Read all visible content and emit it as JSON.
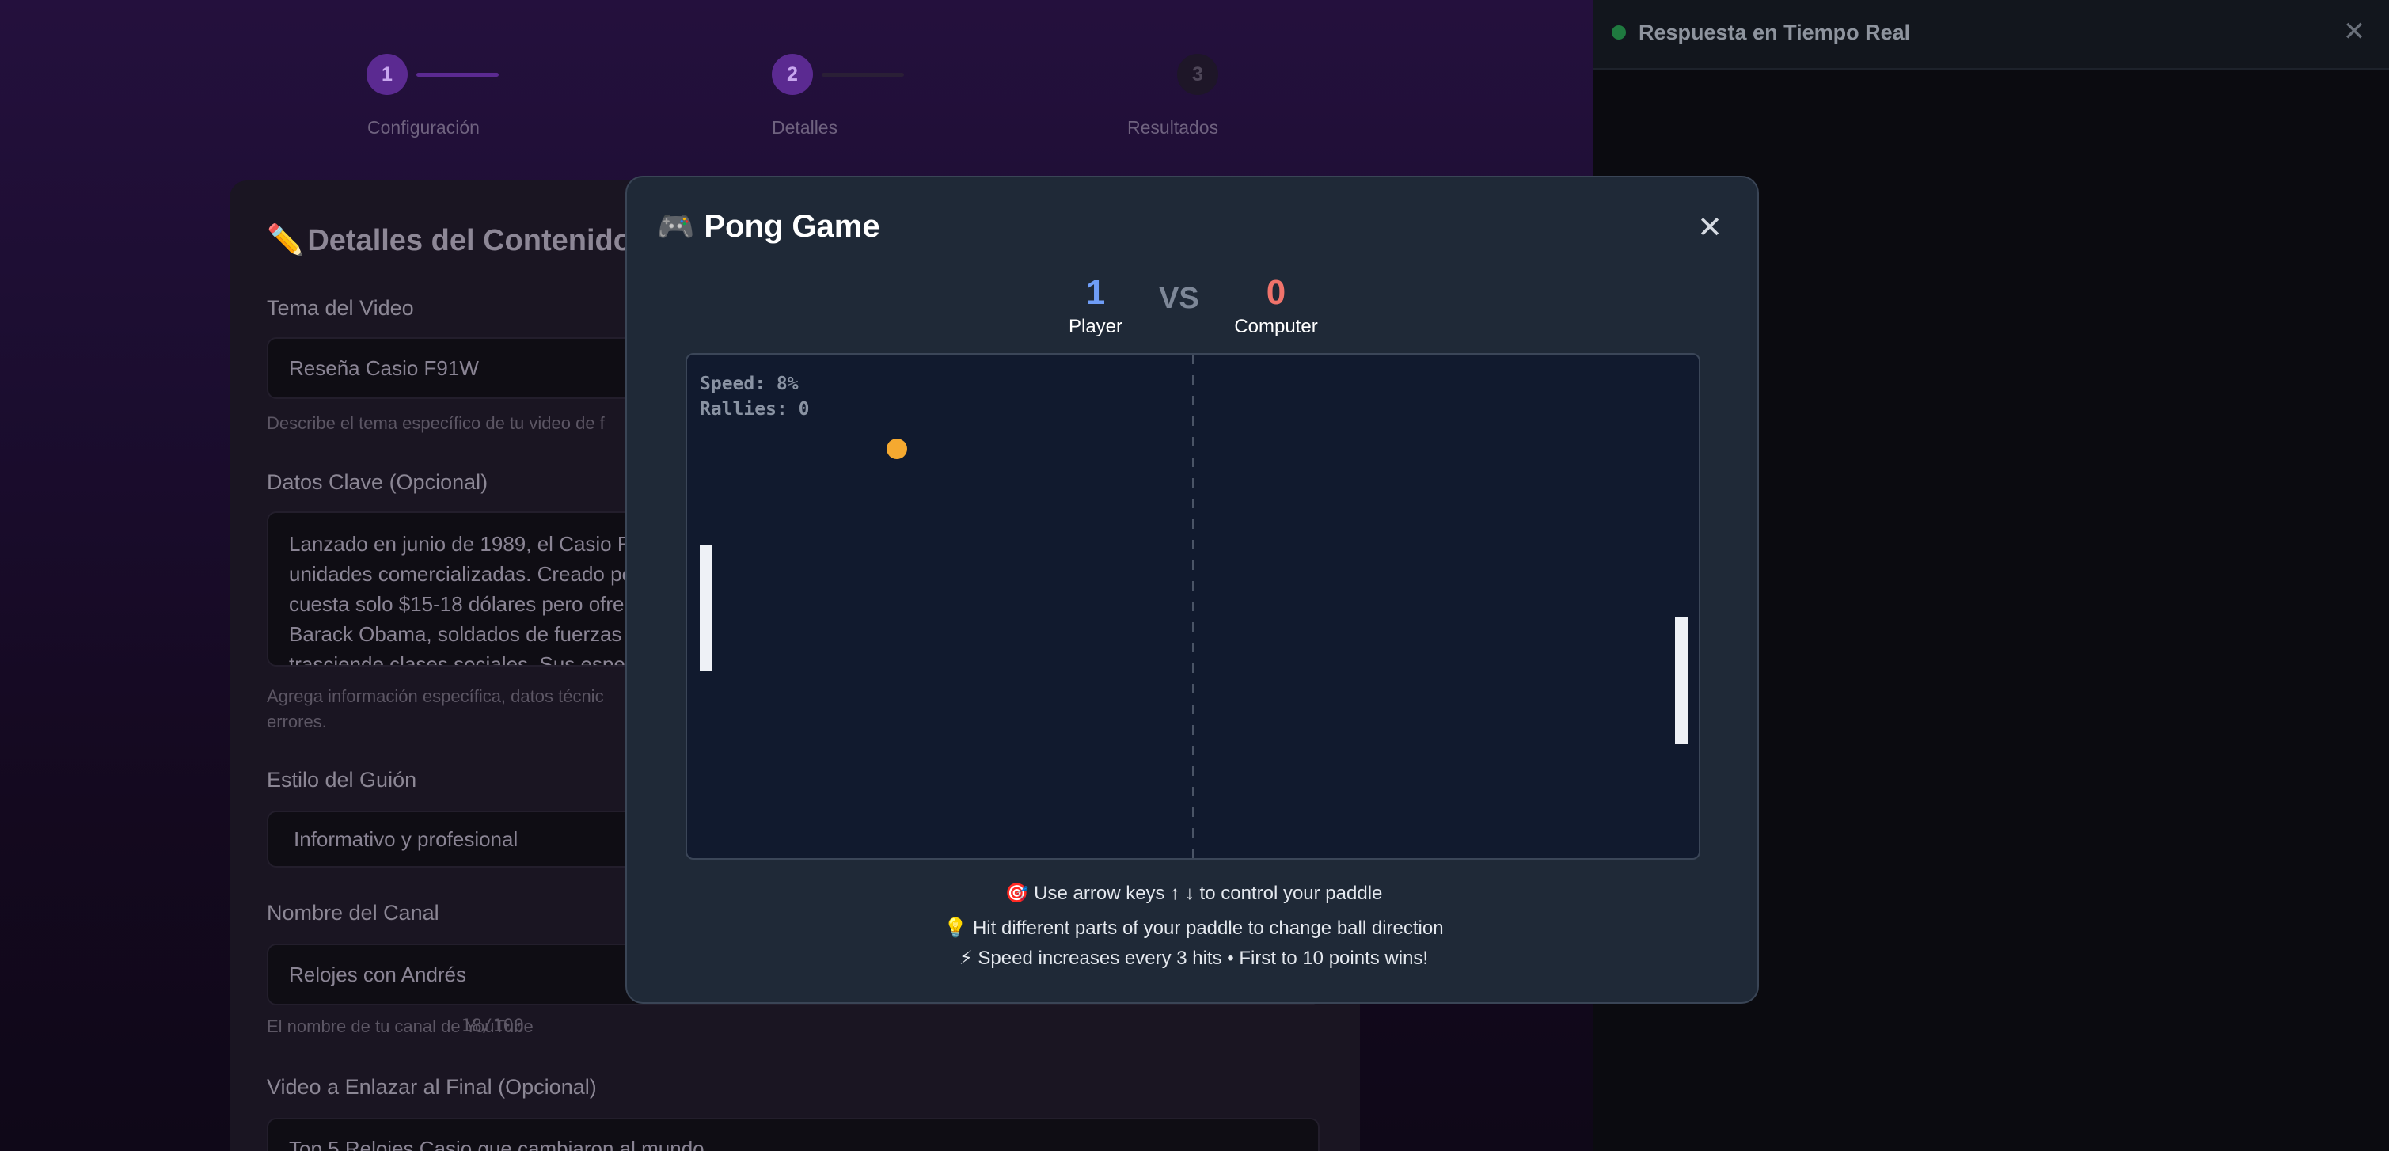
{
  "side_panel": {
    "title": "Respuesta en Tiempo Real",
    "close_icon": "close-icon",
    "status_color": "#1f7a3f"
  },
  "stepper": {
    "steps": [
      {
        "number": "1",
        "label": "Configuración",
        "state": "complete"
      },
      {
        "number": "2",
        "label": "Detalles",
        "state": "active"
      },
      {
        "number": "3",
        "label": "Resultados",
        "state": "pending"
      }
    ]
  },
  "form": {
    "title_icon": "pencil-icon",
    "title": "Detalles del Contenido",
    "topic": {
      "label": "Tema del Video",
      "value": "Reseña Casio F91W",
      "help": "Describe el tema específico de tu video de f"
    },
    "key_data": {
      "label": "Datos Clave (Opcional)",
      "value": "Lanzado en junio de 1989, el Casio F unidades comercializadas. Creado po cuesta solo $15-18 dólares pero ofre Barack Obama, soldados de fuerzas trasciende clases sociales. Sus espe",
      "help": "Agrega información específica, datos técnic errores."
    },
    "style": {
      "label": "Estilo del Guión",
      "value": "Informativo y profesional"
    },
    "channel": {
      "label": "Nombre del Canal",
      "value": "Relojes con Andrés",
      "help": "El nombre de tu canal de YouTube",
      "count": "18/100"
    },
    "end_video": {
      "label": "Video a Enlazar al Final (Opcional)",
      "value": "Top 5 Relojes Casio que cambiaron al mundo"
    }
  },
  "modal": {
    "title_icon": "gamepad-icon",
    "title": "Pong Game",
    "close_icon": "close-icon",
    "score": {
      "player_score": "1",
      "player_label": "Player",
      "vs": "VS",
      "computer_score": "0",
      "computer_label": "Computer",
      "player_color": "#6f9df6",
      "computer_color": "#f0736b"
    },
    "game": {
      "speed": "Speed: 8%",
      "rallies": "Rallies: 0",
      "ball_color": "#f5a930",
      "paddle_color": "#eef1f6"
    },
    "tips": [
      "🎯 Use arrow keys ↑ ↓ to control your paddle",
      "💡 Hit different parts of your paddle to change ball direction",
      "⚡ Speed increases every 3 hits • First to 10 points wins!"
    ]
  }
}
